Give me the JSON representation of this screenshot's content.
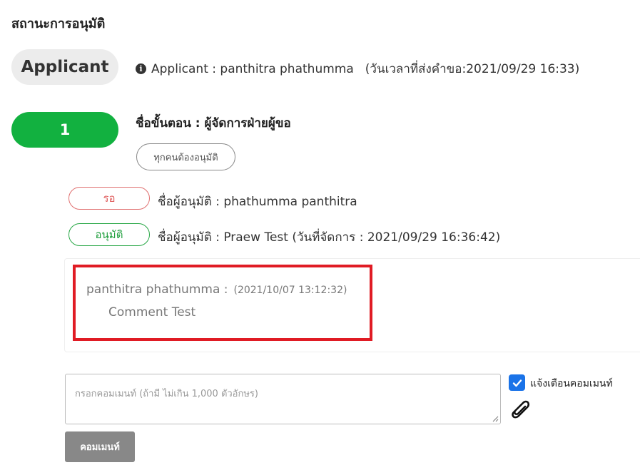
{
  "section": {
    "title": "สถานะการอนุมัติ"
  },
  "applicant": {
    "badge": "Applicant",
    "line_name": "Applicant : panthitra phathumma",
    "line_time": "(วันเวลาที่ส่งคำขอ:2021/09/29 16:33)",
    "icon": "info-circle-icon"
  },
  "step": {
    "number": "1",
    "title": "ชื่อขั้นตอน : ผู้จัดการฝ่ายผู้ขอ",
    "all_approve_label": "ทุกคนต้องอนุมัติ"
  },
  "approvers": [
    {
      "status": "รอ",
      "status_color": "#e06060",
      "line": "ชื่อผู้อนุมัติ : phathumma panthitra"
    },
    {
      "status": "อนุมัติ",
      "status_color": "#1e9e3c",
      "line": "ชื่อผู้อนุมัติ : Praew Test (วันที่จัดการ : 2021/09/29 16:36:42)"
    }
  ],
  "comment": {
    "author": "panthitra phathumma :",
    "time": "(2021/10/07 13:12:32)",
    "text": "Comment Test",
    "highlight_color": "#e01b24"
  },
  "comment_form": {
    "placeholder": "กรอกคอมเมนท์ (ถ้ามี ไม่เกิน 1,000 ตัวอักษร)",
    "value": "",
    "notify_label": "แจ้งเตือนคอมเมนท์",
    "notify_checked": true,
    "attach_icon": "paperclip-icon",
    "submit_label": "คอมเมนท์"
  }
}
